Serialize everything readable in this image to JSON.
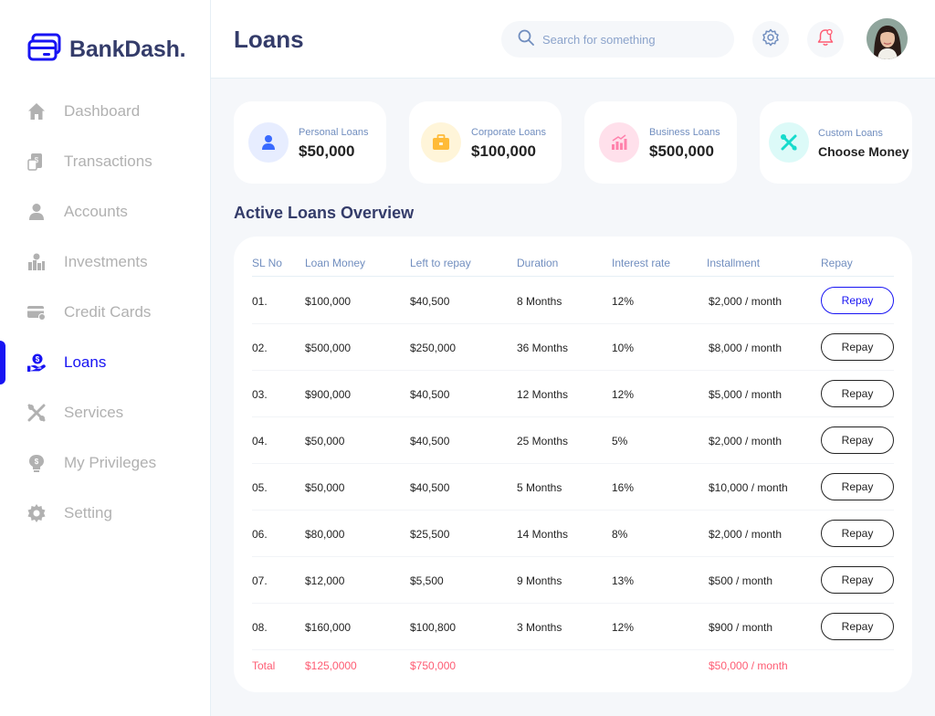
{
  "app": {
    "name": "BankDash."
  },
  "sidebar": {
    "items": [
      {
        "label": "Dashboard",
        "icon": "home-icon"
      },
      {
        "label": "Transactions",
        "icon": "transfer-icon"
      },
      {
        "label": "Accounts",
        "icon": "user-icon"
      },
      {
        "label": "Investments",
        "icon": "investment-icon"
      },
      {
        "label": "Credit Cards",
        "icon": "credit-card-icon"
      },
      {
        "label": "Loans",
        "icon": "loan-icon",
        "active": true
      },
      {
        "label": "Services",
        "icon": "service-icon"
      },
      {
        "label": "My Privileges",
        "icon": "privilege-icon"
      },
      {
        "label": "Setting",
        "icon": "gear-icon"
      }
    ]
  },
  "header": {
    "title": "Loans",
    "search_placeholder": "Search for something"
  },
  "cards": [
    {
      "label": "Personal Loans",
      "value": "$50,000",
      "icon": "user-icon",
      "color": "#396aff",
      "bg": "#e7edff"
    },
    {
      "label": "Corporate Loans",
      "value": "$100,000",
      "icon": "briefcase-icon",
      "color": "#ffbb38",
      "bg": "#fff5d9"
    },
    {
      "label": "Business Loans",
      "value": "$500,000",
      "icon": "chart-icon",
      "color": "#ff82ac",
      "bg": "#ffe0eb"
    },
    {
      "label": "Custom Loans",
      "value": "Choose Money",
      "icon": "tools-icon",
      "color": "#16dbcc",
      "bg": "#dcfaf8"
    }
  ],
  "section": {
    "title": "Active Loans Overview"
  },
  "table": {
    "headers": [
      "SL No",
      "Loan Money",
      "Left to repay",
      "Duration",
      "Interest rate",
      "Installment",
      "Repay"
    ],
    "repay_label": "Repay",
    "rows": [
      [
        "01.",
        "$100,000",
        "$40,500",
        "8 Months",
        "12%",
        "$2,000 / month"
      ],
      [
        "02.",
        "$500,000",
        "$250,000",
        "36 Months",
        "10%",
        "$8,000 / month"
      ],
      [
        "03.",
        "$900,000",
        "$40,500",
        "12 Months",
        "12%",
        "$5,000 / month"
      ],
      [
        "04.",
        "$50,000",
        "$40,500",
        "25 Months",
        "5%",
        "$2,000 / month"
      ],
      [
        "05.",
        "$50,000",
        "$40,500",
        "5 Months",
        "16%",
        "$10,000 / month"
      ],
      [
        "06.",
        "$80,000",
        "$25,500",
        "14 Months",
        "8%",
        "$2,000 / month"
      ],
      [
        "07.",
        "$12,000",
        "$5,500",
        "9 Months",
        "13%",
        "$500 / month"
      ],
      [
        "08.",
        "$160,000",
        "$100,800",
        "3 Months",
        "12%",
        "$900 / month"
      ]
    ],
    "total": {
      "label": "Total",
      "loan_money": "$125,0000",
      "left_to_repay": "$750,000",
      "installment": "$50,000 / month"
    }
  },
  "colors": {
    "accent": "#1814f3",
    "title": "#343c6a",
    "muted": "#b1b1b1",
    "total": "#fe5c73",
    "header_text": "#718ebf"
  }
}
